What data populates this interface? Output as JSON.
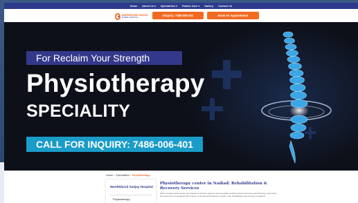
{
  "top_nav": {
    "items": [
      "Home",
      "About Us ▾",
      "Specialities ▾",
      "Patient Care ▾",
      "Gallery",
      "Contact Us"
    ]
  },
  "header": {
    "logo_line1": "WARDWIZARD SANJAY",
    "logo_line2": "SUPER HOSPITAL",
    "enquiry_label": "Enquiry: 7486-006-401",
    "appointment_label": "Book An Appointment"
  },
  "hero": {
    "tagline": "For Reclaim Your Strength",
    "title": "Physiotherapy",
    "subtitle": "SPECIALITY",
    "inquiry": "CALL FOR INQUIRY: 7486-006-401"
  },
  "breadcrumb": {
    "home": "Home",
    "specialities": "Specialities",
    "current": "Physiotherapy"
  },
  "sidebar": {
    "title": "WardWizard Sanjay Hospital",
    "item": "Physiotherapy"
  },
  "article": {
    "title": "Physiotherapy center in Nadiad: Rehabilitation & Recovery Services",
    "body": "With increasing stress levels and changes in lifestyle, patients need specialist medical support and timely physiotherapy intervention. Our department is equipped with a range of services and features to assist in the rehabilitation and recovery of patients."
  },
  "colors": {
    "nav_bg": "#2d3a8c",
    "accent_orange": "#f26a21",
    "hero_bg": "#0d1019",
    "tagline_bg": "#34388a",
    "inquiry_bg": "#1a9cc9"
  },
  "icons": [
    "logo-mark-icon",
    "medical-cross-icon",
    "spine-illustration-icon"
  ]
}
